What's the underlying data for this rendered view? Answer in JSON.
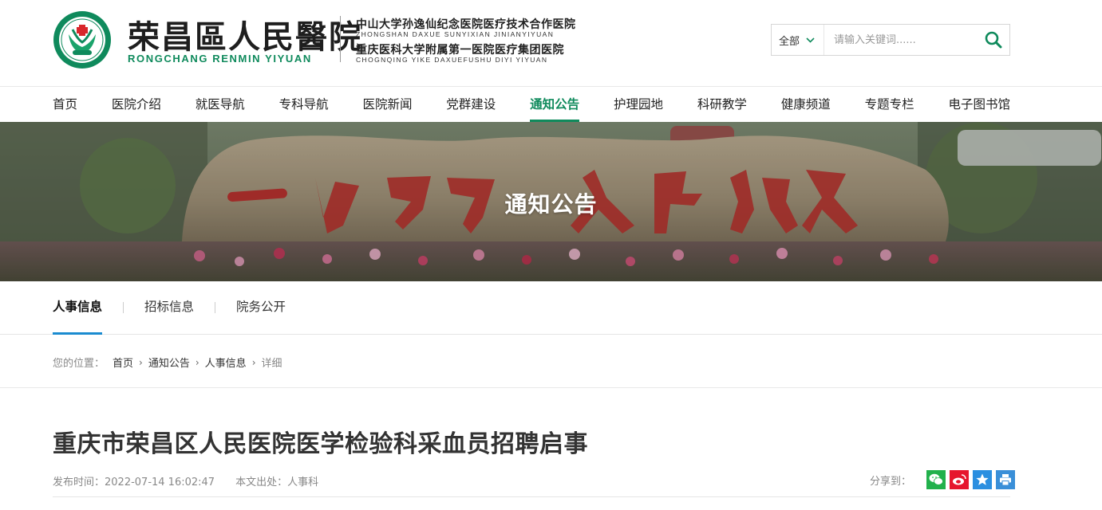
{
  "header": {
    "logo_text_cn": "荣昌區人民醫院",
    "logo_text_en": "RONGCHANG RENMIN YIYUAN",
    "affiliation_1_cn": "中山大学孙逸仙纪念医院医疗技术合作医院",
    "affiliation_1_en": "ZHONGSHAN DAXUE SUNYIXIAN JINIANYIYUAN",
    "affiliation_2_cn": "重庆医科大学附属第一医院医疗集团医院",
    "affiliation_2_en": "CHOGNQING YIKE DAXUEFUSHU DIYI YIYUAN"
  },
  "search": {
    "scope": "全部",
    "placeholder": "请输入关键词......"
  },
  "nav": {
    "items": [
      {
        "label": "首页"
      },
      {
        "label": "医院介绍"
      },
      {
        "label": "就医导航"
      },
      {
        "label": "专科导航"
      },
      {
        "label": "医院新闻"
      },
      {
        "label": "党群建设"
      },
      {
        "label": "通知公告"
      },
      {
        "label": "护理园地"
      },
      {
        "label": "科研教学"
      },
      {
        "label": "健康频道"
      },
      {
        "label": "专题专栏"
      },
      {
        "label": "电子图书馆"
      }
    ],
    "active_index": 6
  },
  "banner": {
    "title": "通知公告",
    "rock_inscription": "一切为了人民健康"
  },
  "subnav": {
    "tabs": [
      {
        "label": "人事信息"
      },
      {
        "label": "招标信息"
      },
      {
        "label": "院务公开"
      }
    ]
  },
  "breadcrumb": {
    "label": "您的位置：",
    "items": [
      "首页",
      "通知公告",
      "人事信息"
    ],
    "current": "详细"
  },
  "article": {
    "title": "重庆市荣昌区人民医院医学检验科采血员招聘启事",
    "publish_time": "发布时间：2022-07-14 16:02:47",
    "source": "本文出处：人事科",
    "share_label": "分享到："
  },
  "colors": {
    "brand_green": "#0f8a5c",
    "subnav_accent": "#1a8bd0",
    "wechat": "#22b14c",
    "weibo": "#e6162d",
    "qzone": "#2b8fe0",
    "print": "#3a8fd8"
  }
}
